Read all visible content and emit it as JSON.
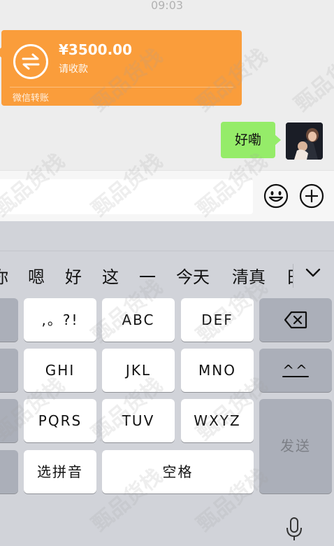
{
  "status": {
    "time": "09:03"
  },
  "transfer": {
    "amount": "¥3500.00",
    "caption": "请收款",
    "footer": "微信转账"
  },
  "message": {
    "text": "好嘞"
  },
  "candidates": [
    "你",
    "嗯",
    "好",
    "这",
    "一",
    "今天",
    "清真",
    "日"
  ],
  "keys": {
    "punct": ",。?!",
    "abc": "ABC",
    "def": "DEF",
    "ghi": "GHI",
    "jkl": "JKL",
    "mno": "MNO",
    "pqrs": "PQRS",
    "tuv": "TUV",
    "wxyz": "WXYZ",
    "caret": "^^",
    "pinyin": "选拼音",
    "space": "空格",
    "send": "发送"
  },
  "watermark": "甄品货栈",
  "colors": {
    "transfer_bg": "#fa9d3b",
    "bubble_bg": "#95ec69",
    "keyboard_bg": "#d1d3d9"
  }
}
